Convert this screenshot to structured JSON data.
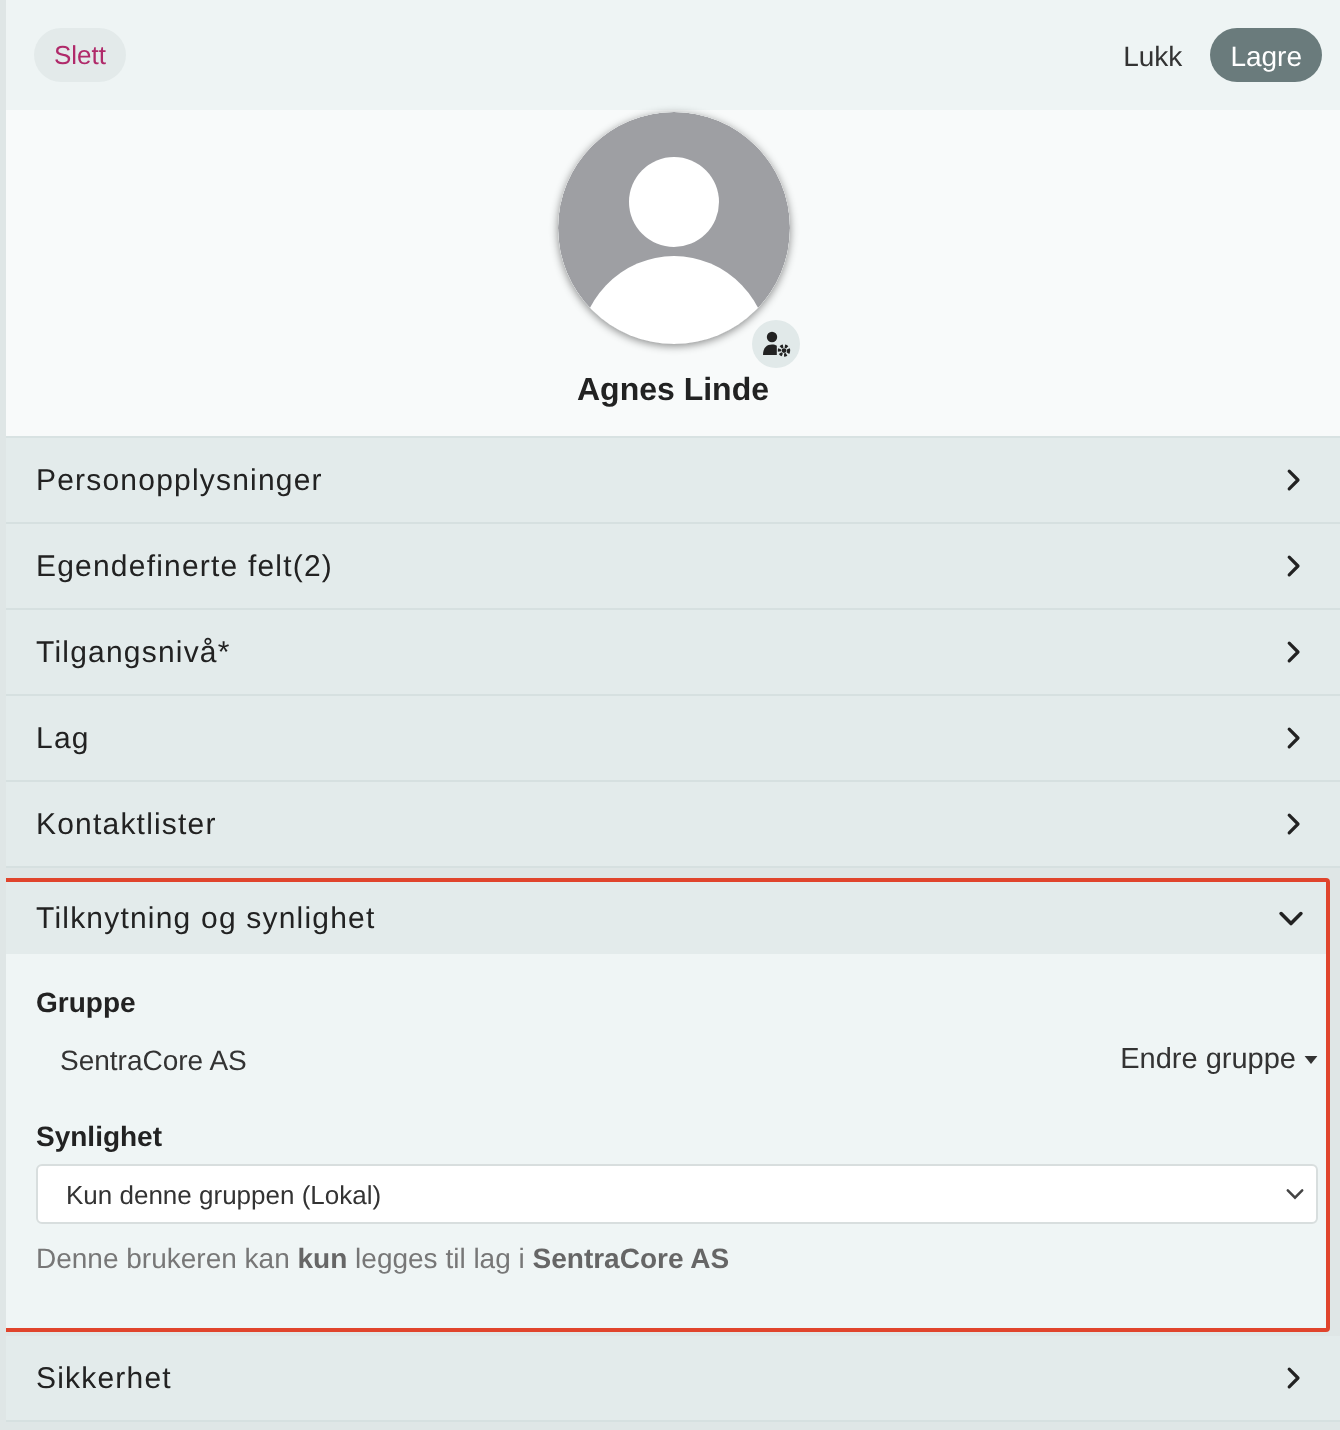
{
  "toolbar": {
    "delete_button": "Slett",
    "close_button": "Lukk",
    "save_button": "Lagre"
  },
  "profile": {
    "name": "Agnes Linde"
  },
  "sections": [
    {
      "title": "Personopplysninger",
      "expanded": false,
      "highlighted": false
    },
    {
      "title": "Egendefinerte felt(2)",
      "expanded": false,
      "highlighted": false
    },
    {
      "title": "Tilgangsnivå*",
      "expanded": false,
      "highlighted": false
    },
    {
      "title": "Lag",
      "expanded": false,
      "highlighted": false
    },
    {
      "title": "Kontaktlister",
      "expanded": false,
      "highlighted": false
    },
    {
      "title": "Tilknytning og synlighet",
      "expanded": true,
      "highlighted": true,
      "content": {
        "group_label": "Gruppe",
        "group_value": "SentraCore AS",
        "change_group_button": "Endre gruppe",
        "visibility_label": "Synlighet",
        "visibility_select": {
          "value": "Kun denne gruppen (Lokal)"
        },
        "help_text": "Denne brukeren kan **kun** legges til lag i **SentraCore AS**"
      }
    },
    {
      "title": "Sikkerhet",
      "expanded": false,
      "highlighted": false
    }
  ]
}
